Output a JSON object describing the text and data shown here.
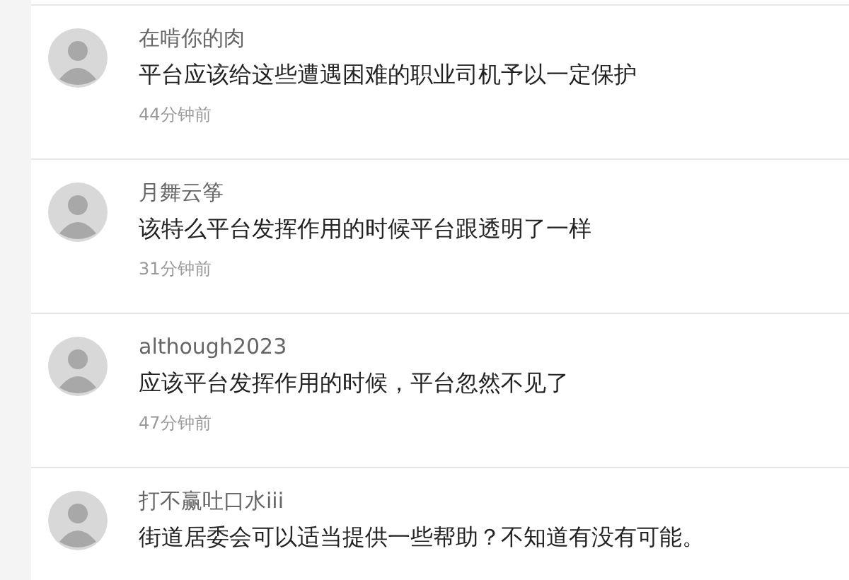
{
  "comments": [
    {
      "user": "在啃你的肉",
      "text": "平台应该给这些遭遇困难的职业司机予以一定保护",
      "time": "44分钟前"
    },
    {
      "user": "月舞云筝",
      "text": "该特么平台发挥作用的时候平台跟透明了一样",
      "time": "31分钟前"
    },
    {
      "user": "although2023",
      "text": "应该平台发挥作用的时候，平台忽然不见了",
      "time": "47分钟前"
    },
    {
      "user": "打不赢吐口水iii",
      "text": "街道居委会可以适当提供一些帮助？不知道有没有可能。"
    }
  ]
}
